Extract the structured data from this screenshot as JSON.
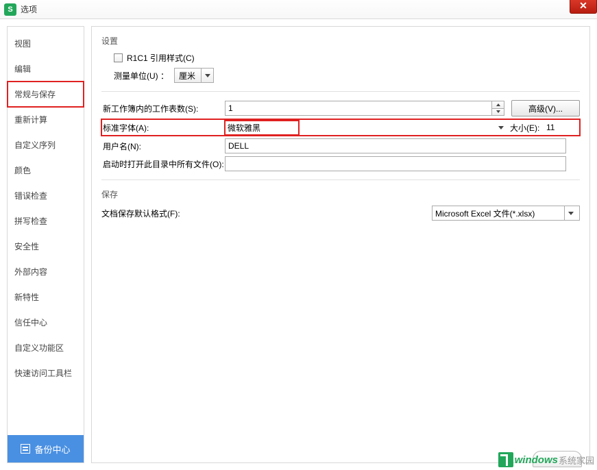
{
  "window": {
    "title": "选项"
  },
  "sidebar": {
    "items": [
      {
        "label": "视图"
      },
      {
        "label": "编辑"
      },
      {
        "label": "常规与保存",
        "selected": true
      },
      {
        "label": "重新计算"
      },
      {
        "label": "自定义序列"
      },
      {
        "label": "颜色"
      },
      {
        "label": "错误检查"
      },
      {
        "label": "拼写检查"
      },
      {
        "label": "安全性"
      },
      {
        "label": "外部内容"
      },
      {
        "label": "新特性"
      },
      {
        "label": "信任中心"
      },
      {
        "label": "自定义功能区"
      },
      {
        "label": "快速访问工具栏"
      }
    ],
    "backup_label": "备份中心"
  },
  "settings": {
    "section_label": "设置",
    "r1c1_label": "R1C1 引用样式(C)",
    "unit_label": "测量单位(U) ：",
    "unit_value": "厘米",
    "sheets_label": "新工作簿内的工作表数(S):",
    "sheets_value": "1",
    "advanced_label": "高级(V)...",
    "font_label": "标准字体(A):",
    "font_value": "微软雅黑",
    "size_label": "大小(E):",
    "size_value": "11",
    "user_label": "用户名(N):",
    "user_value": "DELL",
    "startup_label": "启动时打开此目录中所有文件(O):",
    "startup_value": ""
  },
  "save": {
    "section_label": "保存",
    "format_label": "文档保存默认格式(F):",
    "format_value": "Microsoft Excel 文件(*.xlsx)"
  },
  "watermark": {
    "t1": "windows",
    "t2": "系统家园"
  }
}
